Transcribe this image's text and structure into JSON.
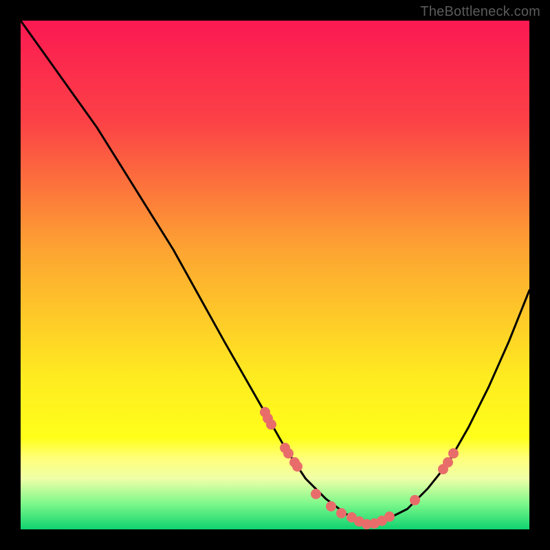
{
  "watermark": "TheBottleneck.com",
  "plot": {
    "area_size": 740,
    "gradient_stops": [
      {
        "offset": 0,
        "color": "#fb1952"
      },
      {
        "offset": 20,
        "color": "#fc4246"
      },
      {
        "offset": 45,
        "color": "#fda432"
      },
      {
        "offset": 70,
        "color": "#feeb20"
      },
      {
        "offset": 82,
        "color": "#ffff1a"
      },
      {
        "offset": 86,
        "color": "#ffff7a"
      },
      {
        "offset": 90,
        "color": "#f0ffa8"
      },
      {
        "offset": 95,
        "color": "#7cf88a"
      },
      {
        "offset": 100,
        "color": "#0fd26f"
      }
    ],
    "curve_color": "#000000",
    "curve_width": 3,
    "marker_color": "#e86d6a"
  },
  "chart_data": {
    "type": "line",
    "title": "",
    "xlabel": "",
    "ylabel": "",
    "xlim": [
      0,
      100
    ],
    "ylim": [
      0,
      100
    ],
    "series": [
      {
        "name": "curve",
        "x": [
          0,
          5,
          10,
          15,
          20,
          25,
          30,
          35,
          40,
          44,
          48,
          52,
          56,
          60,
          64,
          68,
          72,
          76,
          80,
          84,
          88,
          92,
          96,
          100
        ],
        "y": [
          100,
          93,
          86,
          79,
          71,
          63,
          55,
          46,
          37,
          30,
          23,
          16,
          10,
          6,
          3,
          1,
          2,
          4,
          8,
          13,
          20,
          28,
          37,
          47
        ]
      }
    ],
    "markers": [
      {
        "x": 48.0,
        "y": 23.0
      },
      {
        "x": 48.6,
        "y": 21.8
      },
      {
        "x": 49.2,
        "y": 20.6
      },
      {
        "x": 52.0,
        "y": 16.0
      },
      {
        "x": 52.6,
        "y": 15.0
      },
      {
        "x": 53.8,
        "y": 13.2
      },
      {
        "x": 54.4,
        "y": 12.3
      },
      {
        "x": 58.0,
        "y": 7.0
      },
      {
        "x": 61.0,
        "y": 4.5
      },
      {
        "x": 63.0,
        "y": 3.2
      },
      {
        "x": 65.0,
        "y": 2.3
      },
      {
        "x": 66.5,
        "y": 1.6
      },
      {
        "x": 68.0,
        "y": 1.0
      },
      {
        "x": 69.5,
        "y": 1.2
      },
      {
        "x": 71.0,
        "y": 1.7
      },
      {
        "x": 72.5,
        "y": 2.5
      },
      {
        "x": 77.5,
        "y": 5.8
      },
      {
        "x": 83.0,
        "y": 11.8
      },
      {
        "x": 84.0,
        "y": 13.2
      },
      {
        "x": 85.0,
        "y": 15.0
      }
    ]
  }
}
